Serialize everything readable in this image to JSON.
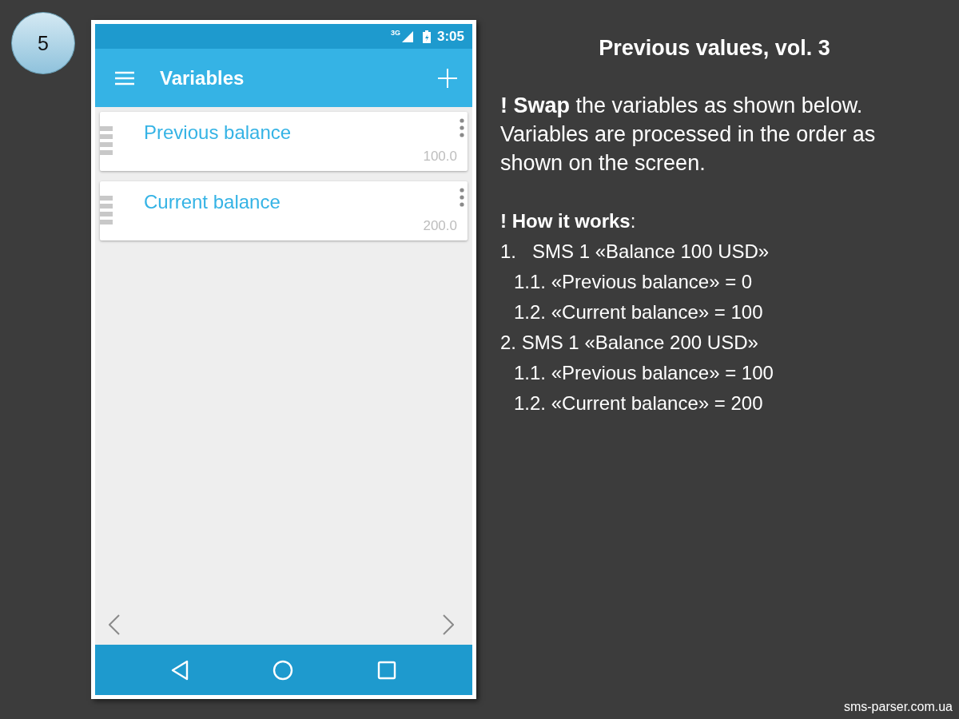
{
  "slide_number": "5",
  "phone": {
    "status_bar": {
      "network": "3G",
      "time": "3:05"
    },
    "title": "Variables",
    "variables": [
      {
        "name": "Previous balance",
        "value": "100.0"
      },
      {
        "name": "Current balance",
        "value": "200.0"
      }
    ]
  },
  "title": "Previous values, vol. 3",
  "intro": "**! Swap** the variables as shown below. Variables are processed in the order as shown on the screen.",
  "how_it_works": {
    "heading": "**! How it works**:",
    "steps": [
      {
        "text": "1.   SMS 1 «Balance 100 USD»",
        "children": [
          {
            "text": "1.1. «Previous balance» = 0"
          },
          {
            "text": "1.2. «Current balance» = 100"
          }
        ]
      },
      {
        "text": "2. SMS 1 «Balance 200 USD»",
        "children": [
          {
            "text": "1.1. «Previous balance» = 100"
          },
          {
            "text": "1.2. «Current balance» = 200"
          }
        ]
      }
    ]
  },
  "footer": "sms-parser.com.ua"
}
